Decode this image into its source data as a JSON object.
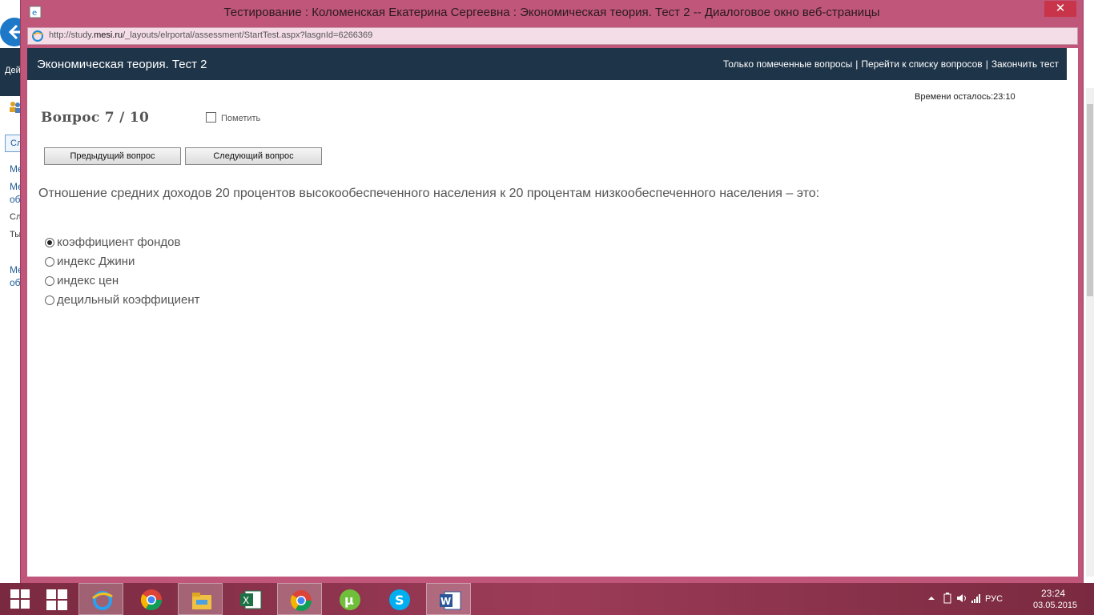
{
  "background_page": {
    "nav_text": "Дей",
    "tab_label": "Сл",
    "links": [
      "Ме",
      "Ме",
      "об",
      "Ме",
      "об"
    ],
    "texts": [
      "Сл",
      "Ты"
    ]
  },
  "dialog": {
    "title": "Тестирование : Коломенская Екатерина Сергеевна : Экономическая теория. Тест 2 -- Диалоговое окно веб-страницы",
    "close_label": "✕",
    "address": {
      "prefix": "http://study.",
      "domain": "mesi.ru",
      "suffix": "/_layouts/elrportal/assessment/StartTest.aspx?lasgnId=6266369"
    }
  },
  "header": {
    "title": "Экономическая теория. Тест 2",
    "links": {
      "marked_only": "Только помеченные вопросы",
      "question_list": "Перейти к списку вопросов",
      "finish": "Закончить тест",
      "separator": "|"
    }
  },
  "timer": "Времени осталось:23:10",
  "question": {
    "number_label": "Вопрос 7 / 10",
    "mark_label": "Пометить",
    "prev_button": "Предыдущий вопрос",
    "next_button": "Следующий вопрос",
    "text": "Отношение средних доходов 20 процентов высокообеспеченного населения к 20 процентам низкообеспеченного населения – это:",
    "answers": [
      {
        "label": "коэффициент фондов",
        "selected": true
      },
      {
        "label": "индекс Джини",
        "selected": false
      },
      {
        "label": "индекс цен",
        "selected": false
      },
      {
        "label": "децильный коэффициент",
        "selected": false
      }
    ]
  },
  "taskbar": {
    "apps": [
      "start-icon",
      "ie-icon",
      "chrome-icon",
      "file-explorer-icon",
      "excel-icon",
      "chrome-icon",
      "utorrent-icon",
      "skype-icon",
      "word-icon"
    ],
    "language": "РУС",
    "time": "23:24",
    "date": "03.05.2015"
  }
}
